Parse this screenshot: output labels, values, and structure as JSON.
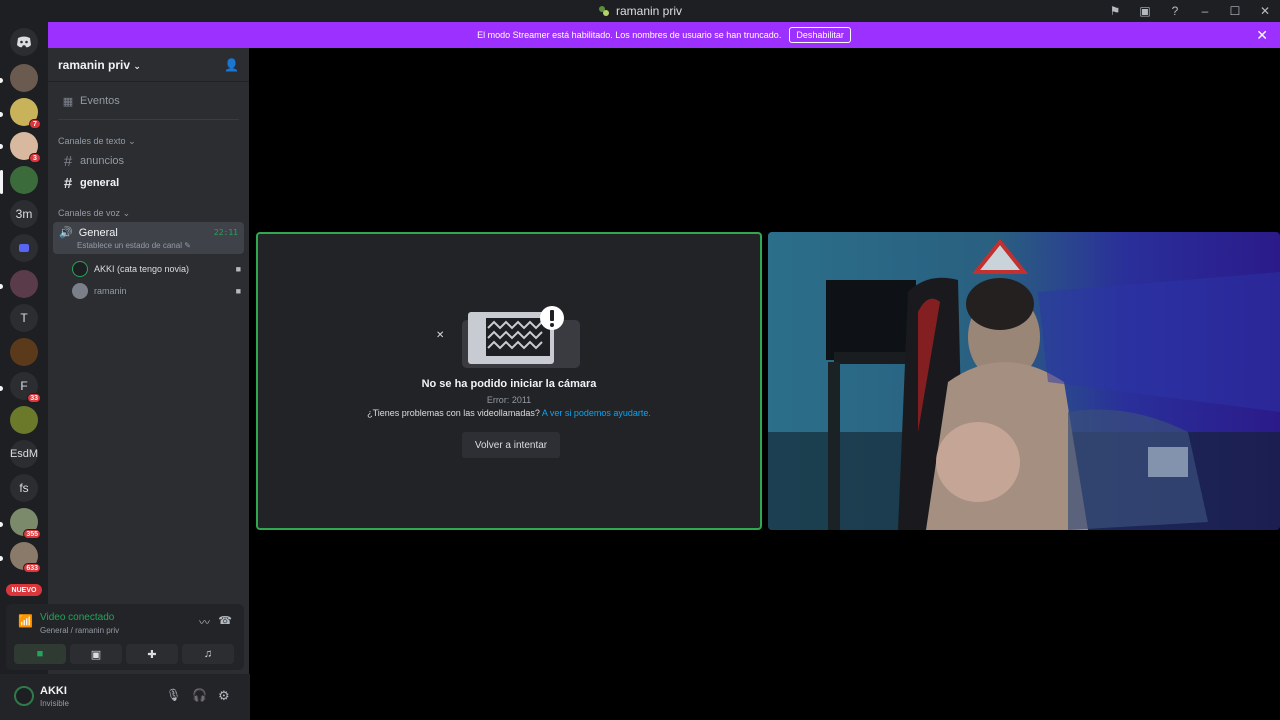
{
  "window": {
    "title": "ramanin priv"
  },
  "banner": {
    "message": "El modo Streamer está habilitado. Los nombres de usuario se han truncado.",
    "disable_label": "Deshabilitar"
  },
  "rail": {
    "servers": [
      {
        "label": "3m"
      },
      {
        "label": "T"
      },
      {
        "label": "F"
      },
      {
        "label": "EsdM"
      },
      {
        "label": "fs"
      }
    ],
    "badges": [
      "7",
      "3",
      "33",
      "355",
      "633"
    ],
    "new_label": "NUEVO"
  },
  "sidebar": {
    "server_name": "ramanin priv",
    "events_label": "Eventos",
    "text_category": "Canales de texto",
    "text_channels": [
      "anuncios",
      "general"
    ],
    "voice_category": "Canales de voz",
    "voice_channel": {
      "name": "General",
      "status": "Establece un estado de canal",
      "time": "22:11",
      "users": [
        "AKKI (cata tengo novia)",
        "ramanin"
      ]
    }
  },
  "voice_panel": {
    "status": "Video conectado",
    "location": "General / ramanin priv"
  },
  "user": {
    "name": "AKKI",
    "status": "Invisible"
  },
  "camera_error": {
    "title": "No se ha podido iniciar la cámara",
    "error": "Error: 2011",
    "help_prefix": "¿Tienes problemas con las videollamadas?",
    "help_link": "A ver si podemos ayudarte.",
    "retry_label": "Volver a intentar"
  },
  "colors": {
    "accent": "#9b30ff",
    "connected": "#23a55a",
    "link": "#00a8fc"
  }
}
